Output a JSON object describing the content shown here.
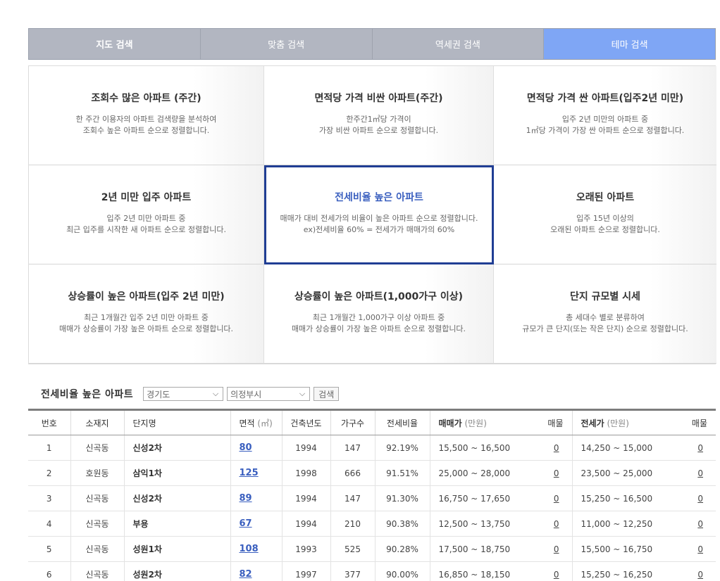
{
  "tabs": [
    {
      "label": "지도 검색"
    },
    {
      "label": "맞춤 검색"
    },
    {
      "label": "역세권 검색"
    },
    {
      "label": "테마 검색"
    }
  ],
  "themes": [
    {
      "title": "조회수 많은 아파트 (주간)",
      "line1": "한 주간 이용자의 아파트 검색량을 분석하여",
      "line2": "조회수 높은 아파트 순으로 정렬합니다."
    },
    {
      "title": "면적당 가격 비싼 아파트(주간)",
      "line1": "한주간1㎡당 가격이",
      "line2": "가장 비싼 아파트 순으로 정렬합니다."
    },
    {
      "title": "면적당 가격 싼 아파트(입주2년 미만)",
      "line1": "입주 2년 미만의 아파트 중",
      "line2": "1㎡당 가격이 가장 싼 아파트 순으로 정렬합니다."
    },
    {
      "title": "2년 미만 입주 아파트",
      "line1": "입주 2년 미만 아파트 중",
      "line2": "최근 입주를 시작한 새 아파트 순으로 정렬합니다."
    },
    {
      "title": "전세비율 높은 아파트",
      "line1": "매매가 대비 전세가의 비율이 높은 아파트 순으로 정렬합니다.",
      "line2": "ex)전세비율 60% = 전세가가 매매가의 60%"
    },
    {
      "title": "오래된 아파트",
      "line1": "입주 15년 이상의",
      "line2": "오래된 아파트 순으로 정렬합니다."
    },
    {
      "title": "상승률이 높은 아파트(입주 2년 미만)",
      "line1": "최근 1개월간 입주 2년 미만 아파트 중",
      "line2": "매매가 상승률이 가장 높은 아파트 순으로 정렬합니다."
    },
    {
      "title": "상승률이 높은 아파트(1,000가구 이상)",
      "line1": "최근 1개월간 1,000가구 이상 아파트 중",
      "line2": "매매가 상승률이 가장 높은 아파트 순으로 정렬합니다."
    },
    {
      "title": "단지 규모별 시세",
      "line1": "총 세대수 별로 분류하여",
      "line2": "규모가 큰 단지(또는 작은 단지) 순으로 정렬합니다."
    }
  ],
  "filter": {
    "title": "전세비율 높은 아파트",
    "province": "경기도",
    "city": "의정부시",
    "search_label": "검색"
  },
  "table": {
    "headers": {
      "no": "번호",
      "location": "소재지",
      "complex": "단지명",
      "area": "면적",
      "area_unit": "(㎡)",
      "year": "건축년도",
      "households": "가구수",
      "ratio": "전세비율",
      "sale": "매매가",
      "sale_unit": "(만원)",
      "sale_listings": "매물",
      "jeonse": "전세가",
      "jeonse_unit": "(만원)",
      "jeonse_listings": "매물"
    },
    "rows": [
      {
        "no": "1",
        "location": "신곡동",
        "complex": "신성2차",
        "area": "80",
        "year": "1994",
        "households": "147",
        "ratio": "92.19%",
        "sale": "15,500 ~ 16,500",
        "sale_cnt": "0",
        "jeonse": "14,250 ~ 15,000",
        "jeonse_cnt": "0"
      },
      {
        "no": "2",
        "location": "호원동",
        "complex": "삼익1차",
        "area": "125",
        "year": "1998",
        "households": "666",
        "ratio": "91.51%",
        "sale": "25,000 ~ 28,000",
        "sale_cnt": "0",
        "jeonse": "23,500 ~ 25,000",
        "jeonse_cnt": "0"
      },
      {
        "no": "3",
        "location": "신곡동",
        "complex": "신성2차",
        "area": "89",
        "year": "1994",
        "households": "147",
        "ratio": "91.30%",
        "sale": "16,750 ~ 17,650",
        "sale_cnt": "0",
        "jeonse": "15,250 ~ 16,500",
        "jeonse_cnt": "0"
      },
      {
        "no": "4",
        "location": "신곡동",
        "complex": "부용",
        "area": "67",
        "year": "1994",
        "households": "210",
        "ratio": "90.38%",
        "sale": "12,500 ~ 13,750",
        "sale_cnt": "0",
        "jeonse": "11,000 ~ 12,250",
        "jeonse_cnt": "0"
      },
      {
        "no": "5",
        "location": "신곡동",
        "complex": "성원1차",
        "area": "108",
        "year": "1993",
        "households": "525",
        "ratio": "90.28%",
        "sale": "17,500 ~ 18,750",
        "sale_cnt": "0",
        "jeonse": "15,500 ~ 16,750",
        "jeonse_cnt": "0"
      },
      {
        "no": "6",
        "location": "신곡동",
        "complex": "성원2차",
        "area": "82",
        "year": "1997",
        "households": "377",
        "ratio": "90.00%",
        "sale": "16,850 ~ 18,150",
        "sale_cnt": "0",
        "jeonse": "15,250 ~ 16,250",
        "jeonse_cnt": "0"
      }
    ]
  }
}
